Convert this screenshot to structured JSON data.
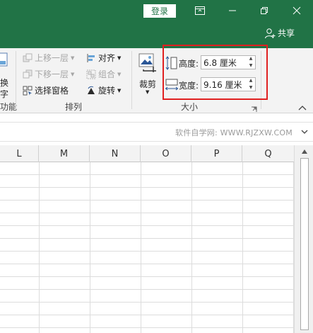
{
  "titlebar": {
    "login_label": "登录",
    "share_label": "共享"
  },
  "ribbon": {
    "left_cut": {
      "label_1": "换",
      "label_2": "字",
      "group_label": "功能"
    },
    "arrange": {
      "bring_forward": "上移一层",
      "send_backward": "下移一层",
      "selection_pane": "选择窗格",
      "align": "对齐",
      "group": "组合",
      "rotate": "旋转",
      "group_label": "排列"
    },
    "crop": {
      "label": "裁剪"
    },
    "size": {
      "height_label": "高度:",
      "height_value": "6.8 厘米",
      "width_label": "宽度:",
      "width_value": "9.16 厘米",
      "group_label": "大小"
    }
  },
  "formula_bar": {
    "watermark": "软件自学网: WWW.RJZXW.COM"
  },
  "grid": {
    "columns": [
      "L",
      "M",
      "N",
      "O",
      "P",
      "Q"
    ]
  },
  "colors": {
    "title_green": "#217346",
    "highlight_red": "#e02020"
  },
  "icons": {
    "display_options": "ribbon-display-icon",
    "minimize": "minimize-icon",
    "restore": "restore-icon",
    "close": "close-icon",
    "share": "person-add-icon"
  }
}
